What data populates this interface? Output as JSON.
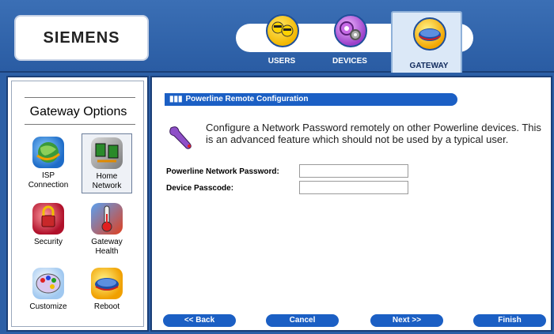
{
  "header": {
    "logo": "SIEMENS",
    "nav": [
      {
        "label": "USERS",
        "icon": "users-icon"
      },
      {
        "label": "DEVICES",
        "icon": "devices-icon"
      },
      {
        "label": "GATEWAY",
        "icon": "gateway-icon",
        "active": true
      }
    ]
  },
  "sidebar": {
    "title": "Gateway Options",
    "options": [
      {
        "label": "ISP Connection",
        "icon": "isp-connection-icon"
      },
      {
        "label": "Home Network",
        "icon": "home-network-icon",
        "selected": true
      },
      {
        "label": "Security",
        "icon": "security-icon"
      },
      {
        "label": "Gateway Health",
        "icon": "gateway-health-icon"
      },
      {
        "label": "Customize",
        "icon": "customize-icon"
      },
      {
        "label": "Reboot",
        "icon": "reboot-icon"
      }
    ]
  },
  "main": {
    "section_title": "Powerline Remote Configuration",
    "description": "Configure a Network Password remotely on other Powerline devices. This is an advanced feature which should not be used by a typical user.",
    "fields": [
      {
        "label": "Powerline Network Password:",
        "value": ""
      },
      {
        "label": "Device Passcode:",
        "value": ""
      }
    ]
  },
  "buttons": {
    "back": "<< Back",
    "cancel": "Cancel",
    "next": "Next >>",
    "finish": "Finish"
  },
  "colors": {
    "brand_blue": "#2c5fa6",
    "button_blue": "#1b5fc4"
  }
}
